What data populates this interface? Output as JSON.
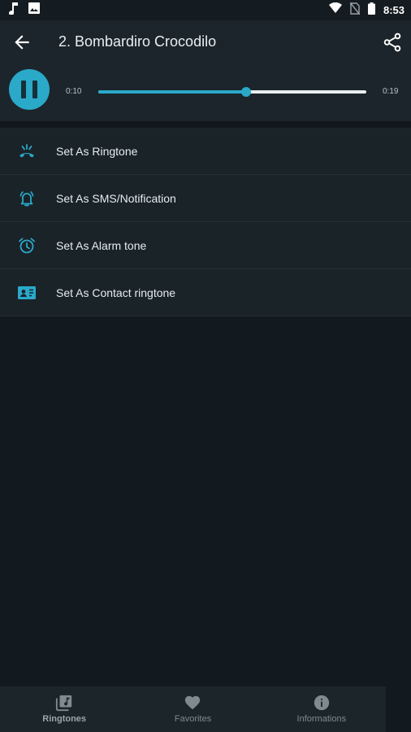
{
  "status_bar": {
    "time": "8:53",
    "left_icons": [
      "music-note-icon",
      "image-icon"
    ],
    "right_icons": [
      "wifi-icon",
      "no-sim-icon",
      "battery-icon"
    ]
  },
  "app_bar": {
    "title": "2. Bombardiro Crocodilo",
    "back_icon": "arrow-left-icon",
    "share_icon": "share-icon"
  },
  "player": {
    "state_icon": "pause-icon",
    "current_time": "0:10",
    "total_time": "0:19",
    "progress": 0.55
  },
  "menu": {
    "items": [
      {
        "label": "Set As Ringtone",
        "icon": "phone-ringing-icon"
      },
      {
        "label": "Set As SMS/Notification",
        "icon": "notification-bell-icon"
      },
      {
        "label": "Set As Alarm tone",
        "icon": "alarm-clock-icon"
      },
      {
        "label": "Set As Contact ringtone",
        "icon": "contact-card-icon"
      }
    ]
  },
  "bottom_nav": {
    "tabs": [
      {
        "label": "Ringtones",
        "icon": "music-library-icon",
        "active": true
      },
      {
        "label": "Favorites",
        "icon": "heart-icon",
        "active": false
      },
      {
        "label": "Informations",
        "icon": "info-icon",
        "active": false
      }
    ]
  },
  "colors": {
    "accent": "#2aa9c9",
    "background": "#121a20",
    "surface": "#1c252b"
  }
}
